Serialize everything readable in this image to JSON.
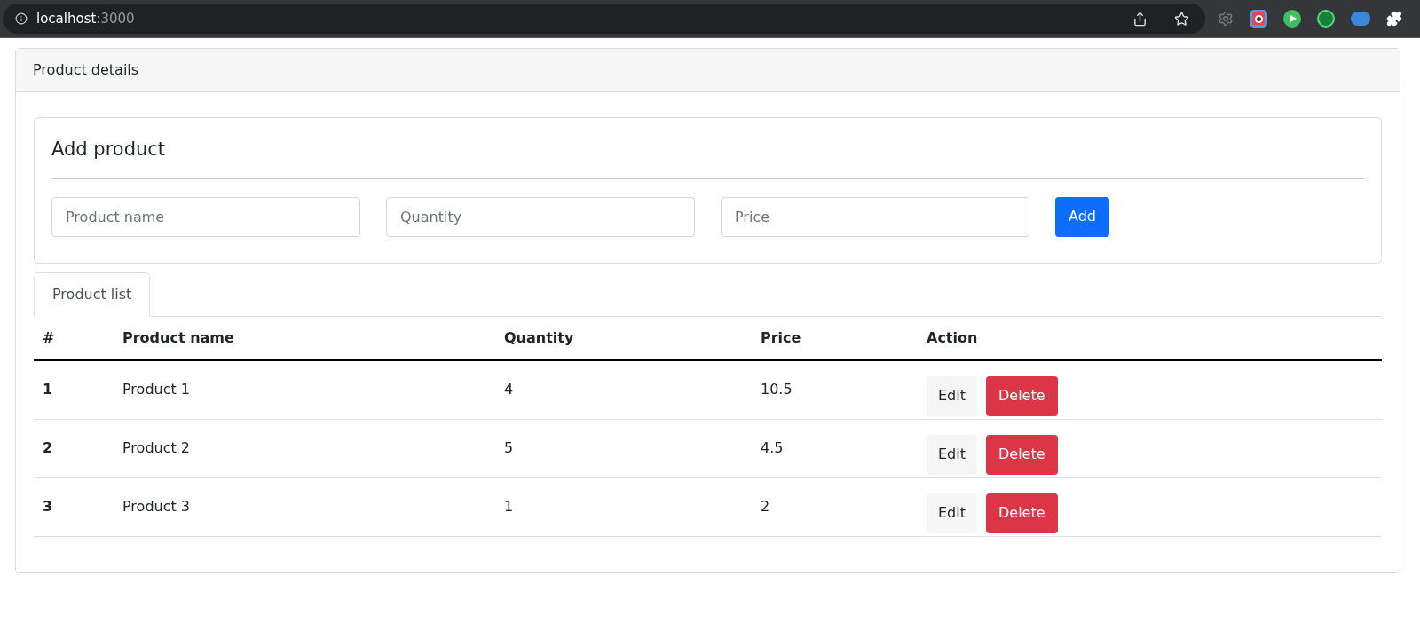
{
  "browser": {
    "host": "localhost",
    "port": ":3000"
  },
  "card": {
    "title": "Product details"
  },
  "add_form": {
    "title": "Add product",
    "fields": [
      {
        "placeholder": "Product name"
      },
      {
        "placeholder": "Quantity"
      },
      {
        "placeholder": "Price"
      }
    ],
    "button": "Add"
  },
  "tabs": [
    {
      "label": "Product list",
      "selected": true
    }
  ],
  "table": {
    "columns": [
      "#",
      "Product name",
      "Quantity",
      "Price",
      "Action"
    ],
    "rows": [
      {
        "number": "1",
        "name": "Product 1",
        "quantity": "4",
        "price": "10.5",
        "actions": [
          "Edit",
          "Delete"
        ]
      },
      {
        "number": "2",
        "name": "Product 2",
        "quantity": "5",
        "price": "4.5",
        "actions": [
          "Edit",
          "Delete"
        ]
      },
      {
        "number": "3",
        "name": "Product 3",
        "quantity": "1",
        "price": "2",
        "actions": [
          "Edit",
          "Delete"
        ]
      }
    ]
  }
}
